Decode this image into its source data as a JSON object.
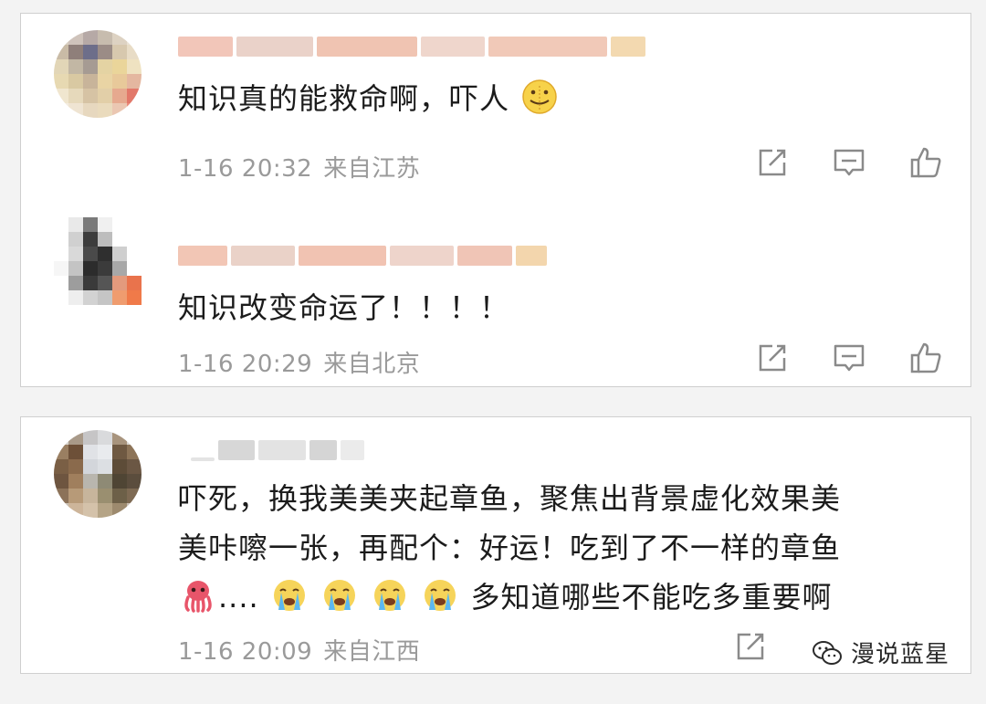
{
  "comments": [
    {
      "text": "知识真的能救命啊，吓人",
      "time": "1-16 20:32",
      "location": "来自江苏"
    },
    {
      "text": "知识改变命运了！！！！",
      "time": "1-16 20:29",
      "location": "来自北京"
    },
    {
      "text_line1": "吓死，换我美美夹起章鱼，聚焦出背景虚化效果美",
      "text_line2": "美咔嚓一张，再配个：好运！吃到了不一样的章鱼",
      "text_line3_dots": "....",
      "text_line3_tail": "多知道哪些不能吃多重要啊",
      "time": "1-16 20:09",
      "location": "来自江西"
    }
  ],
  "icons": {
    "share": "share-icon",
    "comment": "comment-icon",
    "like": "thumbs-up-icon",
    "emoji_smile": "zipper-smile-emoji",
    "emoji_octopus": "octopus-emoji",
    "emoji_crying": "loudly-crying-emoji",
    "watermark_logo": "wechat-icon"
  },
  "watermark": {
    "label": "漫说蓝星"
  },
  "colors": {
    "meta_text": "#9a9a9a",
    "card_border": "#cfcfcf",
    "background": "#f3f3f3"
  }
}
